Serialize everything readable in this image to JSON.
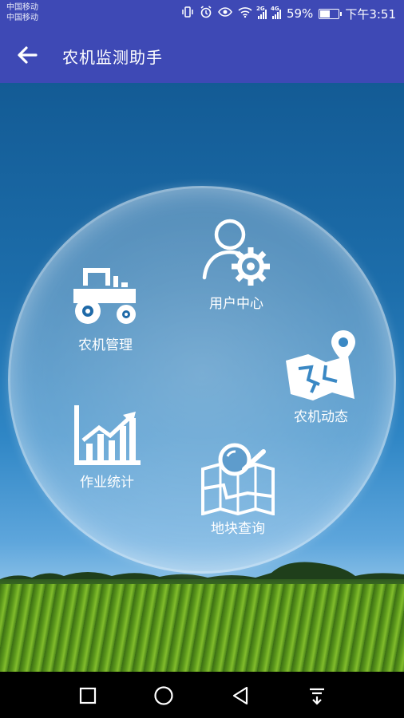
{
  "status_bar": {
    "carrier_1": "中国移动",
    "carrier_2": "中国移动",
    "network_1": "2G",
    "network_2": "4G",
    "battery_percent": "59%",
    "battery_level": 0.59,
    "time": "下午3:51"
  },
  "app_bar": {
    "title": "农机监测助手",
    "back_icon": "arrow-left-icon"
  },
  "menu": {
    "user_center": {
      "label": "用户中心",
      "icon": "user-gear-icon"
    },
    "machine_management": {
      "label": "农机管理",
      "icon": "tractor-icon"
    },
    "machine_dynamics": {
      "label": "农机动态",
      "icon": "map-pin-icon"
    },
    "work_statistics": {
      "label": "作业统计",
      "icon": "bar-chart-icon"
    },
    "plot_query": {
      "label": "地块查询",
      "icon": "map-search-icon"
    }
  },
  "nav_bar": {
    "recent_icon": "square-icon",
    "home_icon": "circle-icon",
    "back_icon": "triangle-back-icon",
    "notification_icon": "pull-down-icon"
  },
  "colors": {
    "app_bar": "#3e49b5",
    "sky_top": "#135b95",
    "nav_bar": "#000000"
  }
}
